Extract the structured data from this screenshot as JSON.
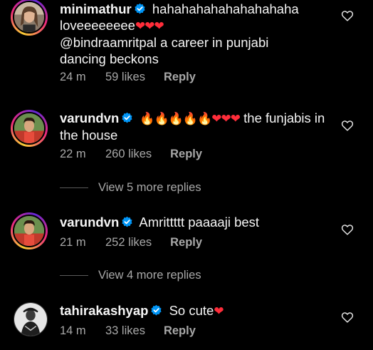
{
  "comments": [
    {
      "username": "minimathur",
      "text_before": "hahahahahahahahahaha loveeeeeeee",
      "emoji_after": "❤❤❤",
      "text_line2": "@bindraamritpal a career in punjabi dancing beckons",
      "time": "24 m",
      "likes": "59 likes",
      "reply": "Reply"
    },
    {
      "username": "varundvn",
      "emoji_before": "🔥🔥🔥🔥🔥❤❤❤",
      "text": "the funjabis in the house",
      "time": "22 m",
      "likes": "260 likes",
      "reply": "Reply",
      "view_more": "View 5 more replies"
    },
    {
      "username": "varundvn",
      "text": "Amrittttt paaaaji best",
      "time": "21 m",
      "likes": "252 likes",
      "reply": "Reply",
      "view_more": "View 4 more replies"
    },
    {
      "username": "tahirakashyap",
      "text": "So cute",
      "emoji_after": "❤",
      "time": "14 m",
      "likes": "33 likes",
      "reply": "Reply"
    }
  ],
  "colors": {
    "background": "#000000",
    "text": "#f5f5f5",
    "secondary_text": "#a8a8a8",
    "verified_badge": "#0095f6",
    "heart_emoji": "#ff2d3a"
  },
  "icons": {
    "verified": "verified-badge-icon",
    "like": "heart-outline-icon"
  }
}
